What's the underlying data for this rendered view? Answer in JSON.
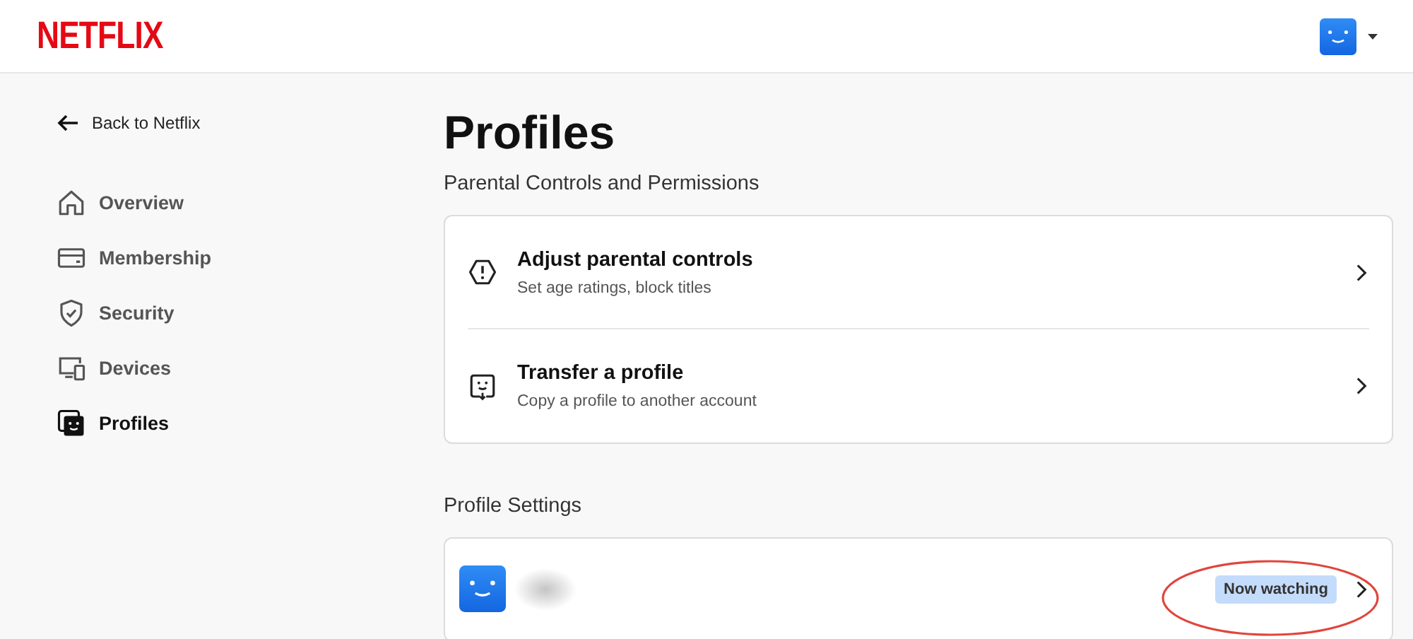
{
  "header": {
    "logo": "NETFLIX"
  },
  "sidebar": {
    "back_link": "Back to Netflix",
    "items": [
      {
        "label": "Overview",
        "kind": "home",
        "selected": false
      },
      {
        "label": "Membership",
        "kind": "card",
        "selected": false
      },
      {
        "label": "Security",
        "kind": "shield",
        "selected": false
      },
      {
        "label": "Devices",
        "kind": "devices",
        "selected": false
      },
      {
        "label": "Profiles",
        "kind": "profiles",
        "selected": true
      }
    ]
  },
  "main": {
    "title": "Profiles",
    "subtitle": "Parental Controls and Permissions",
    "options": [
      {
        "title": "Adjust parental controls",
        "description": "Set age ratings, block titles",
        "kind": "warning"
      },
      {
        "title": "Transfer a profile",
        "description": "Copy a profile to another account",
        "kind": "transfer"
      }
    ],
    "section": "Profile Settings",
    "profiles": [
      {
        "badge": "Now watching",
        "highlighted": true
      }
    ]
  }
}
